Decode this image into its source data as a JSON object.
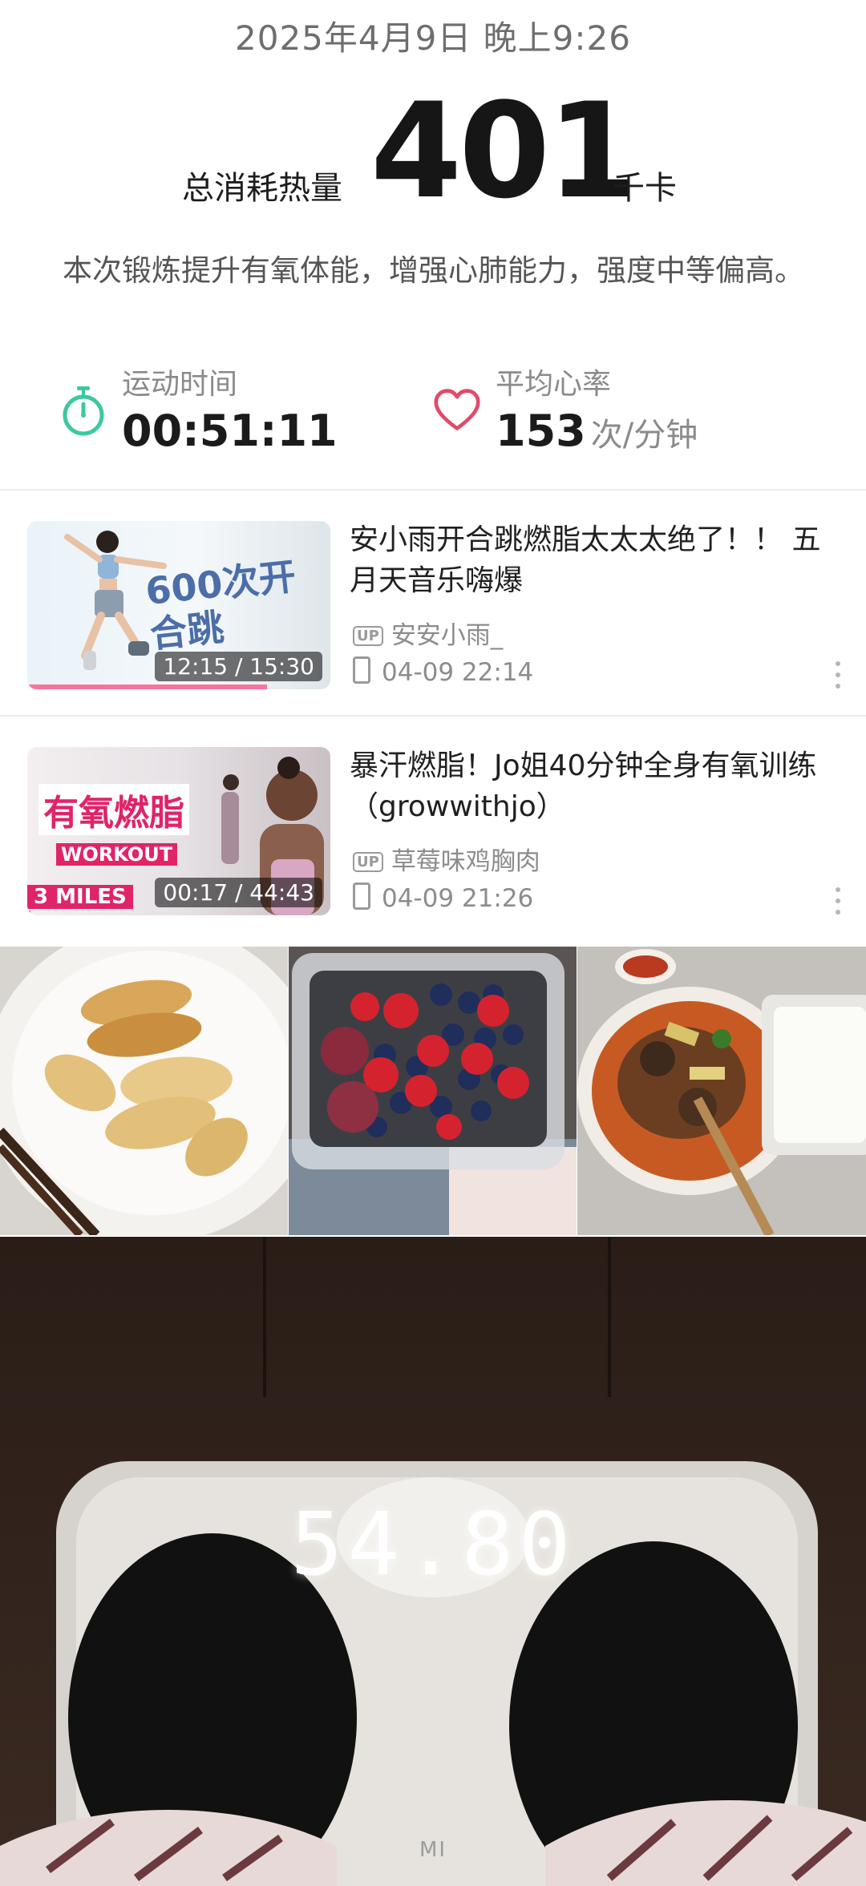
{
  "workout": {
    "datetime": "2025年4月9日 晚上9:26",
    "calories_label": "总消耗热量",
    "calories_value": "401",
    "calories_unit": "千卡",
    "description": "本次锻炼提升有氧体能，增强心肺能力，强度中等偏高。",
    "duration_label": "运动时间",
    "duration_value": "00:51:11",
    "heart_rate_label": "平均心率",
    "heart_rate_value": "153",
    "heart_rate_unit": "次/分钟",
    "colors": {
      "timer_icon": "#3cc9a0",
      "heart_icon": "#e24a6a"
    }
  },
  "videos": [
    {
      "title": "安小雨开合跳燃脂太太太绝了！！ 五月天音乐嗨爆",
      "thumb_text": "600次开合跳",
      "duration": "12:15 / 15:30",
      "progress": 0.79,
      "up_badge": "UP",
      "uploader": "安安小雨_",
      "time": "04-09 22:14"
    },
    {
      "title": "暴汗燃脂！Jo姐40分钟全身有氧训练（growwithjo）",
      "thumb_text": "有氧燃脂",
      "thumb_sub1": "WORKOUT",
      "thumb_sub2": "3 MILES",
      "duration": "00:17 / 44:43",
      "progress": 0.006,
      "up_badge": "UP",
      "uploader": "草莓味鸡胸肉",
      "time": "04-09 21:26"
    }
  ],
  "scale": {
    "reading": "54.80",
    "brand": "MI"
  }
}
